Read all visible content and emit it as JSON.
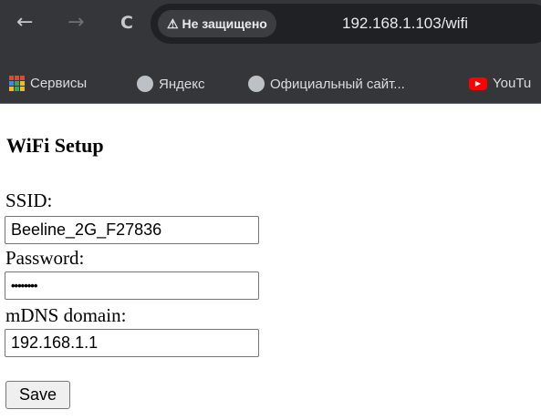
{
  "browser": {
    "back": "←",
    "forward": "→",
    "reload": "C",
    "security_label": "Не защищено",
    "url": "192.168.1.103/wifi"
  },
  "bookmarks": [
    {
      "label": "Сервисы",
      "icon": "apps-grid-icon"
    },
    {
      "label": "Яндекс",
      "icon": "globe-icon"
    },
    {
      "label": "Официальный сайт...",
      "icon": "globe-icon"
    },
    {
      "label": "YouTu",
      "icon": "youtube-icon"
    }
  ],
  "page": {
    "title": "WiFi Setup",
    "ssid_label": "SSID:",
    "ssid_value": "Beeline_2G_F27836",
    "password_label": "Password:",
    "password_value": "••••••••",
    "mdns_label": "mDNS domain:",
    "mdns_value": "192.168.1.1",
    "save_label": "Save"
  }
}
